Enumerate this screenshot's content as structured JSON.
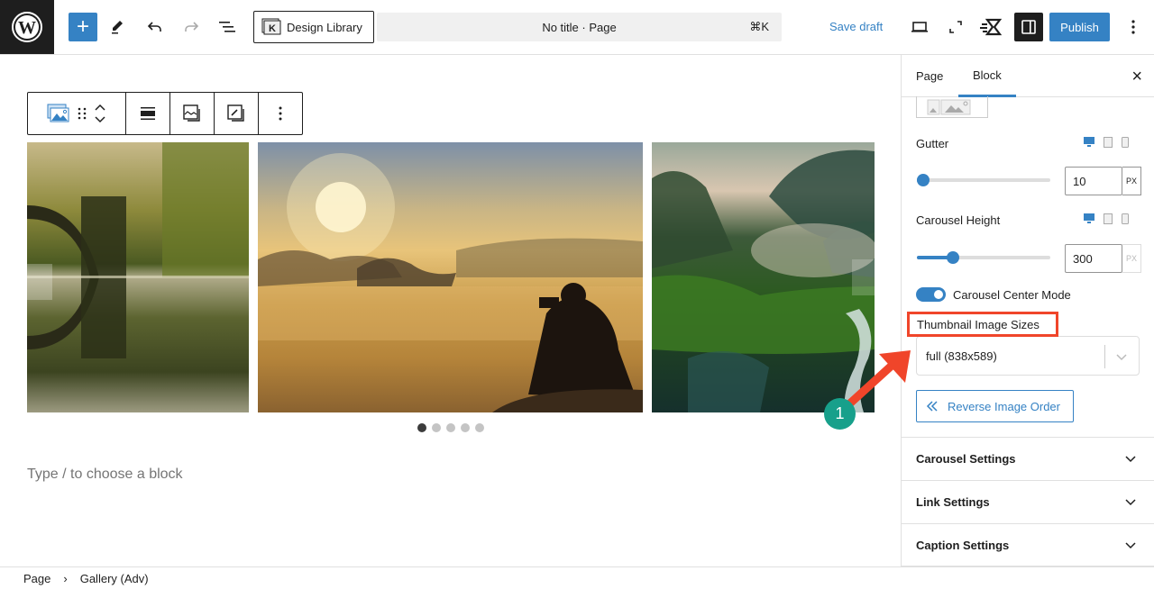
{
  "topbar": {
    "logo": "wordpress-logo",
    "add_block": "+",
    "design_library_label": "Design Library",
    "command_title": "No title · Page",
    "command_shortcut": "⌘K",
    "save_draft_label": "Save draft",
    "publish_label": "Publish",
    "icons": [
      "plus-icon",
      "pencil-icon",
      "undo-icon",
      "redo-icon",
      "document-overview-icon",
      "design-library-icon",
      "desktop-preview-icon",
      "fullscreen-icon",
      "plugin-icon",
      "sidebar-toggle-icon",
      "more-vertical-icon"
    ]
  },
  "block_toolbar": {
    "icons": [
      "gallery-block-icon",
      "drag-handle-icon",
      "move-up-icon",
      "move-down-icon",
      "align-icon",
      "replace-image-icon",
      "edit-image-icon",
      "more-options-icon"
    ]
  },
  "gallery": {
    "slides": [
      {
        "name": "bridge-reflection"
      },
      {
        "name": "photographer-sunrise"
      },
      {
        "name": "misty-jungle-river"
      }
    ],
    "dots_total": 5,
    "active_dot": 0
  },
  "canvas": {
    "placeholder": "Type / to choose a block"
  },
  "footer": {
    "breadcrumb": [
      "Page",
      "Gallery (Adv)"
    ],
    "separator": "›"
  },
  "panel": {
    "tabs": [
      {
        "label": "Page",
        "active": false
      },
      {
        "label": "Block",
        "active": true
      }
    ],
    "close": "×",
    "gutter": {
      "label": "Gutter",
      "value": "10",
      "unit": "PX",
      "fraction": 0.02
    },
    "carousel_height": {
      "label": "Carousel Height",
      "value": "300",
      "unit": "PX",
      "fraction": 0.27
    },
    "center_mode": {
      "label": "Carousel Center Mode",
      "enabled": true
    },
    "thumbnail_sizes": {
      "label": "Thumbnail Image Sizes",
      "selected": "full (838x589)"
    },
    "reverse_label": "Reverse Image Order",
    "sections": [
      "Carousel Settings",
      "Link Settings",
      "Caption Settings"
    ]
  },
  "annotation": {
    "badge": "1",
    "color": "#f0452a",
    "badge_color": "#17a08b"
  },
  "colors": {
    "accent": "#3582c4",
    "dark": "#1e1e1e"
  }
}
